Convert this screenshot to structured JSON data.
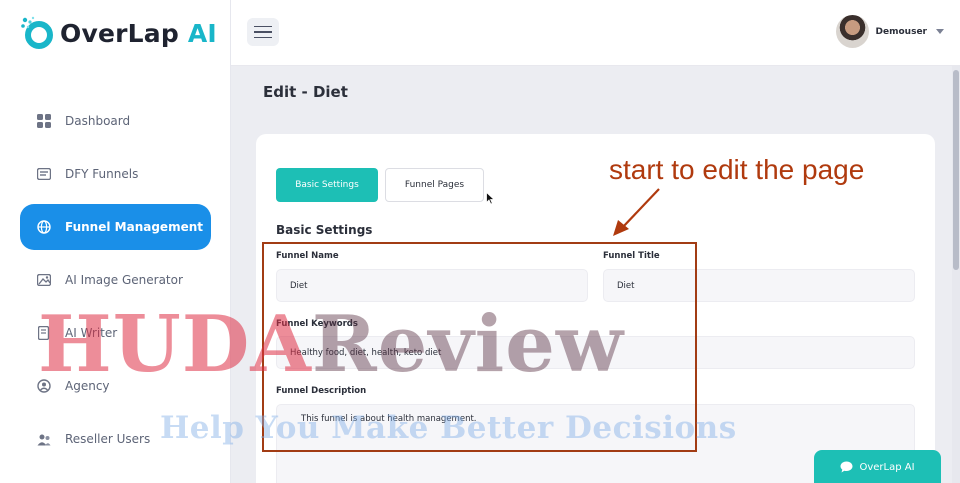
{
  "app": {
    "logo_text": "OverLap",
    "logo_accent": "AI",
    "brand_color": "#19b6c9"
  },
  "header": {
    "user_name": "Demouser",
    "menu_icon": "hamburger-icon"
  },
  "sidebar": {
    "items": [
      {
        "label": "Dashboard",
        "icon": "dashboard-grid-icon",
        "active": false
      },
      {
        "label": "DFY Funnels",
        "icon": "funnel-list-icon",
        "active": false
      },
      {
        "label": "Funnel Management",
        "icon": "globe-icon",
        "active": true
      },
      {
        "label": "AI Image Generator",
        "icon": "image-icon",
        "active": false
      },
      {
        "label": "AI Writer",
        "icon": "document-edit-icon",
        "active": false
      },
      {
        "label": "Agency",
        "icon": "agency-icon",
        "active": false
      },
      {
        "label": "Reseller Users",
        "icon": "users-icon",
        "active": false
      }
    ],
    "active_color": "#1a8fe8"
  },
  "page": {
    "title": "Edit - Diet"
  },
  "tabs": {
    "basic": "Basic Settings",
    "pages": "Funnel Pages",
    "active_color": "#1dbfb5"
  },
  "form": {
    "section_title": "Basic Settings",
    "funnel_name_label": "Funnel Name",
    "funnel_name_value": "Diet",
    "funnel_title_label": "Funnel Title",
    "funnel_title_value": "Diet",
    "keywords_label": "Funnel Keywords",
    "keywords_value": "Healthy food, diet, health, keto diet",
    "description_label": "Funnel Description",
    "description_value": "This funnel is about health management."
  },
  "annotation": {
    "text": "start to edit the page",
    "color": "#b03a0e"
  },
  "watermark": {
    "part1": "HUDA",
    "part2": "Review",
    "tagline": "Help You Make Better Decisions"
  },
  "chat": {
    "label": "OverLap AI",
    "icon": "chat-bubble-icon"
  }
}
